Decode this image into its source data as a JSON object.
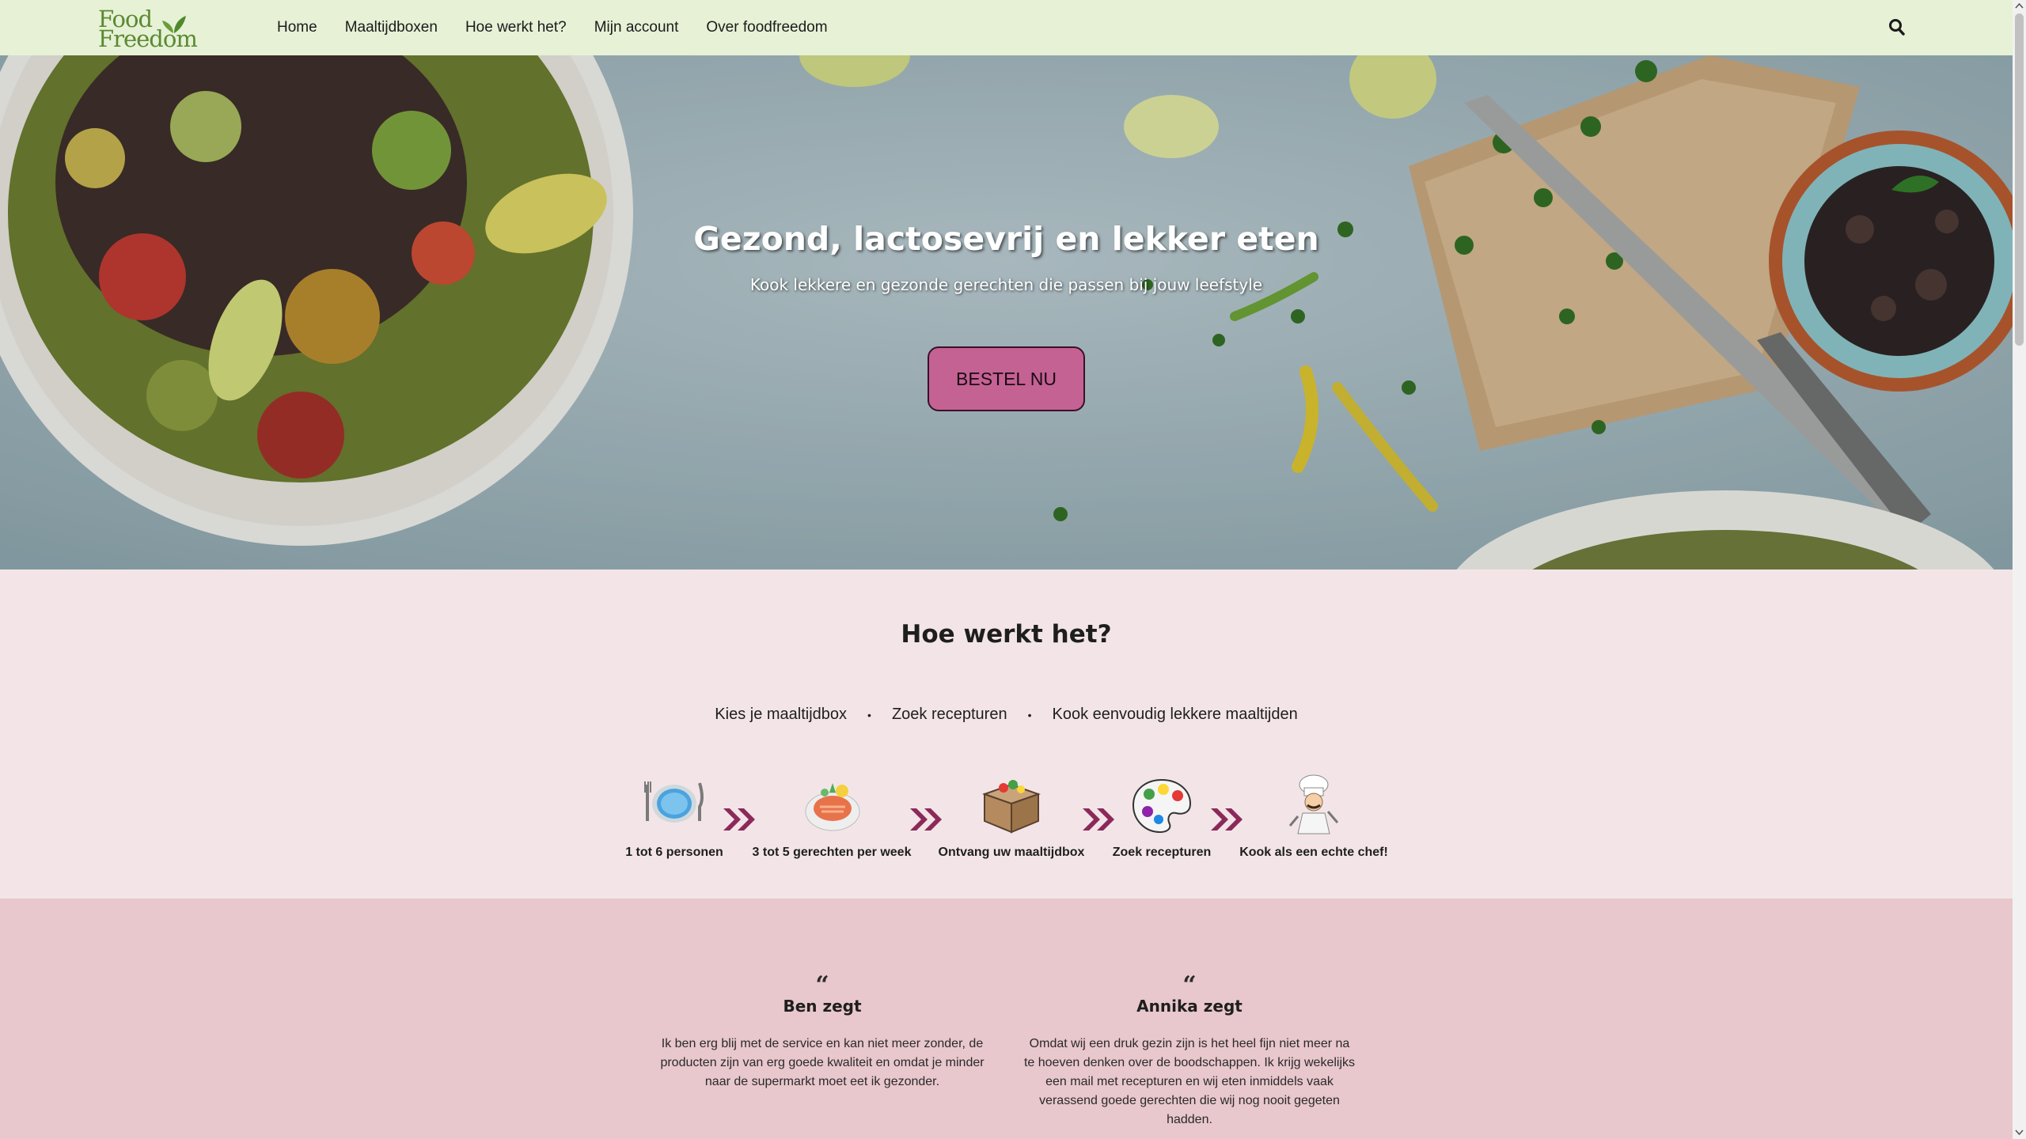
{
  "brand": {
    "logo_line1": "Food",
    "logo_line2": "Freedom",
    "green": "#5b8a32"
  },
  "nav": {
    "items": [
      {
        "label": "Home"
      },
      {
        "label": "Maaltijdboxen"
      },
      {
        "label": "Hoe werkt het?"
      },
      {
        "label": "Mijn account"
      },
      {
        "label": "Over foodfreedom"
      }
    ],
    "search_icon": "search-icon",
    "background": "#e6f1d6"
  },
  "hero": {
    "title": "Gezond, lactosevrij en lekker eten",
    "subtitle": "Kook lekkere en gezonde gerechten die passen bij jouw leefstyle",
    "cta_label": "BESTEL NU",
    "cta_color": "#c46294"
  },
  "how": {
    "title": "Hoe werkt het?",
    "steps_line": [
      "Kies je maaltijdbox",
      "Zoek recepturen",
      "Kook eenvoudig lekkere maaltijden"
    ],
    "separator": "•",
    "steps": [
      {
        "label": "1 tot 6 personen",
        "icon": "plate-icon"
      },
      {
        "label": "3 tot 5 gerechten per week",
        "icon": "dish-icon"
      },
      {
        "label": "Ontvang uw maaltijdbox",
        "icon": "box-icon"
      },
      {
        "label": "Zoek recepturen",
        "icon": "palette-icon"
      },
      {
        "label": "Kook als een echte chef!",
        "icon": "chef-icon"
      }
    ],
    "arrow_icon": "double-chevron-icon",
    "background": "#f3e5e7"
  },
  "testimonials": {
    "background": "#e8c7cd",
    "quote_mark": "“",
    "items": [
      {
        "name": "Ben zegt",
        "text": "Ik ben erg blij met de service en kan niet meer zonder, de producten zijn van erg goede kwaliteit en omdat je minder naar de supermarkt moet eet ik gezonder."
      },
      {
        "name": "Annika zegt",
        "text": "Omdat wij een druk gezin zijn is het heel fijn niet meer na te hoeven denken over de boodschappen. Ik krijg wekelijks een mail met recepturen en wij eten inmiddels vaak verassend goede gerechten die wij nog nooit gegeten hadden."
      }
    ]
  }
}
